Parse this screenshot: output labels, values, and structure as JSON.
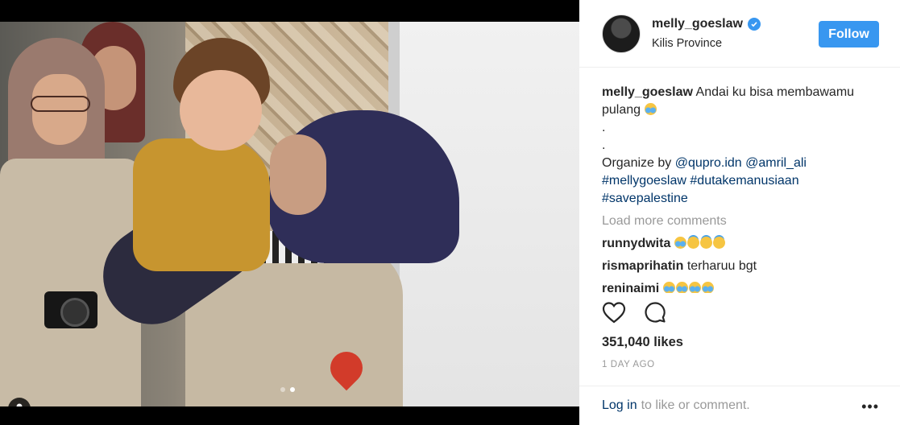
{
  "post": {
    "username": "melly_goeslaw",
    "location": "Kilis Province",
    "follow_label": "Follow",
    "caption_user": "melly_goeslaw",
    "caption_text": "Andai ku bisa membawamu pulang",
    "caption_dot1": ".",
    "caption_dot2": ".",
    "organize_prefix": "Organize by",
    "mention1": "@qupro.idn",
    "mention2": "@amril_ali",
    "hashtag1": "#mellygoeslaw",
    "hashtag2": "#dutakemanusiaan",
    "hashtag3": "#savepalestine",
    "load_more": "Load more comments",
    "comments": [
      {
        "user": "runnydwita",
        "text": ""
      },
      {
        "user": "rismaprihatin",
        "text": "terharuu bgt"
      },
      {
        "user": "reninaimi",
        "text": ""
      }
    ],
    "likes": "351,040 likes",
    "time": "1 DAY AGO",
    "login_label": "Log in",
    "login_suffix": "to like or comment.",
    "more_label": "•••"
  },
  "carousel": {
    "count": 2,
    "active_index": 1
  },
  "colors": {
    "accent": "#3897f0",
    "link": "#003569",
    "muted": "#999999"
  },
  "icons": [
    "verified-badge-icon",
    "heart-icon",
    "comment-icon",
    "user-tag-icon",
    "more-options-icon"
  ]
}
